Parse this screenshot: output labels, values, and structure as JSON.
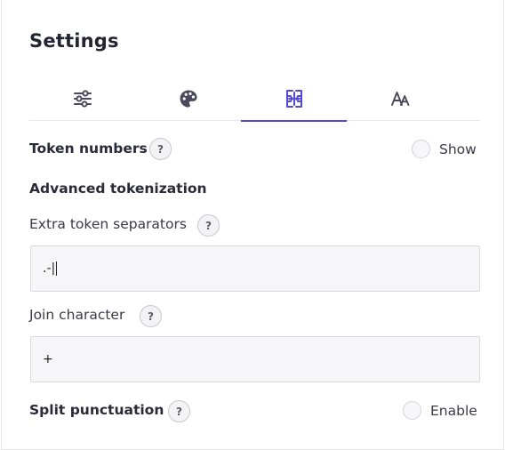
{
  "title": "Settings",
  "tabs": [
    {
      "icon": "sliders-icon",
      "active": false
    },
    {
      "icon": "palette-icon",
      "active": false
    },
    {
      "icon": "split-columns-icon",
      "active": true
    },
    {
      "icon": "font-size-icon",
      "active": false
    }
  ],
  "colors": {
    "accent": "#5548d9",
    "icon": "#4a4a5c"
  },
  "token_numbers": {
    "label": "Token numbers",
    "help": "?",
    "toggle_label": "Show",
    "checked": false
  },
  "advanced": {
    "heading": "Advanced tokenization",
    "extra_separators": {
      "label": "Extra token separators",
      "help": "?",
      "value": ".-|"
    },
    "join_character": {
      "label": "Join character",
      "help": "?",
      "value": "+"
    },
    "split_punctuation": {
      "label": "Split punctuation",
      "help": "?",
      "toggle_label": "Enable",
      "checked": false
    }
  }
}
